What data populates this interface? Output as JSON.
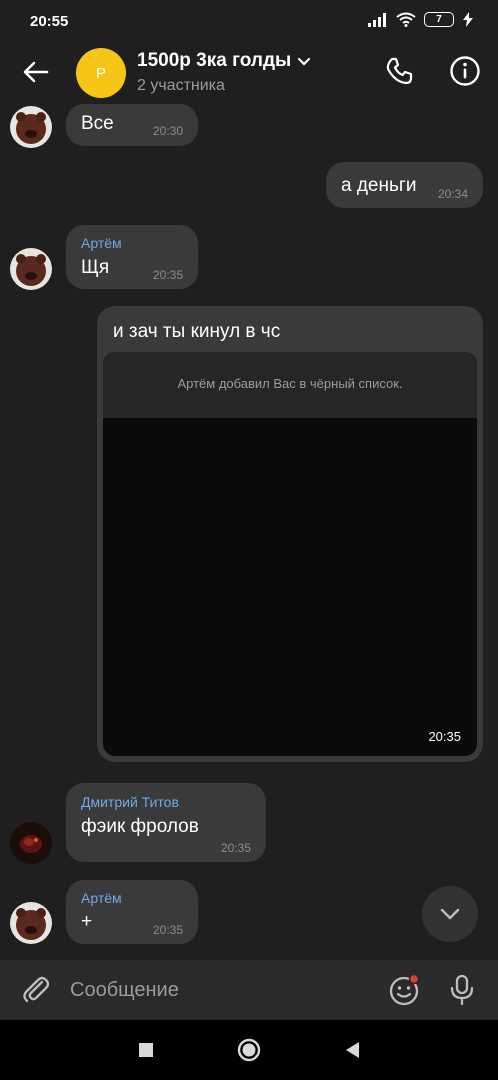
{
  "status_bar": {
    "time": "20:55",
    "battery": "7"
  },
  "header": {
    "avatar_letter": "P",
    "title": "1500р 3ка голды",
    "subtitle": "2 участника",
    "avatar_color": "#f5c518"
  },
  "messages": [
    {
      "text": "Все",
      "time": "20:30"
    },
    {
      "text": "а деньги",
      "time": "20:34"
    },
    {
      "sender": "Артём",
      "text": "Щя",
      "time": "20:35"
    },
    {
      "caption": "и зач ты кинул в чс",
      "media_notice": "Артём добавил Вас в чёрный список.",
      "time": "20:35"
    },
    {
      "sender": "Дмитрий Титов",
      "text": "фэик фролов",
      "time": "20:35"
    },
    {
      "sender": "Артём",
      "text": "+",
      "time": "20:35"
    }
  ],
  "composer": {
    "placeholder": "Сообщение"
  },
  "colors": {
    "background": "#1f1f1f",
    "bubble": "#3a3a3a",
    "sender_name": "#6fa8e6",
    "accent": "#f5c518"
  },
  "icons": [
    "back-arrow-icon",
    "phone-icon",
    "info-icon",
    "chevron-down-icon",
    "paperclip-icon",
    "emoji-icon",
    "microphone-icon",
    "scroll-down-icon"
  ]
}
